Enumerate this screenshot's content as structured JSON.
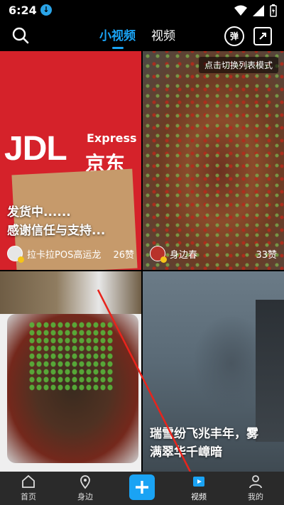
{
  "status": {
    "time": "6:24"
  },
  "topnav": {
    "tabs": [
      {
        "label": "小视频",
        "active": true
      },
      {
        "label": "视频",
        "active": false
      }
    ],
    "danmu_label": "弹"
  },
  "cards": [
    {
      "title_line1": "发货中......",
      "title_line2": "感谢信任与支持...",
      "author": "拉卡拉POS高运龙",
      "likes": "26赞",
      "brand_logo": "JDL",
      "brand_express": "Express",
      "brand_cn": "京东快"
    },
    {
      "tag": "点击切换列表模式",
      "author": "身边春",
      "likes": "33赞"
    },
    {},
    {
      "title_line1": "瑞雪纷飞兆丰年，雾",
      "title_line2": "满翠华千嶂暗"
    }
  ],
  "bottomnav": {
    "items": [
      {
        "label": "首页",
        "icon": "home-icon"
      },
      {
        "label": "身边",
        "icon": "location-icon"
      },
      {
        "label": "",
        "icon": "plus-icon"
      },
      {
        "label": "视频",
        "icon": "video-icon",
        "active": true
      },
      {
        "label": "我的",
        "icon": "profile-icon"
      }
    ]
  },
  "colors": {
    "accent": "#1aa3f4",
    "background": "#000000",
    "nav_bg": "#2a2a2a",
    "arrow": "#e8241c"
  }
}
